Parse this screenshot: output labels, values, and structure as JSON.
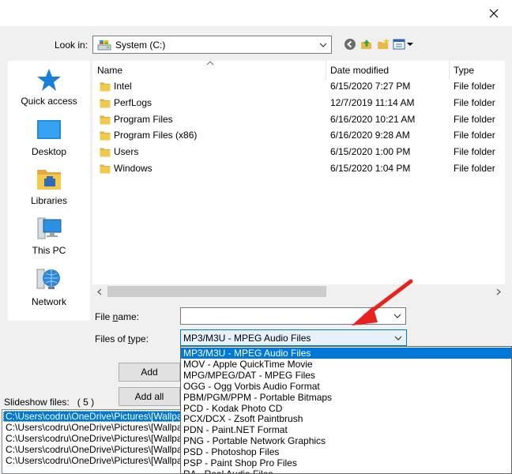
{
  "window": {
    "close_icon": "close-icon"
  },
  "toolbar": {
    "lookin_label": "Look in:",
    "lookin_value": "System (C:)",
    "drive_icon": "drive-icon",
    "back_icon": "back-icon",
    "up_icon": "up-folder-icon",
    "new_folder_icon": "new-folder-icon",
    "view_icon": "view-menu-icon"
  },
  "places": [
    {
      "label": "Quick access",
      "icon": "star-icon"
    },
    {
      "label": "Desktop",
      "icon": "desktop-icon"
    },
    {
      "label": "Libraries",
      "icon": "libraries-icon"
    },
    {
      "label": "This PC",
      "icon": "computer-icon"
    },
    {
      "label": "Network",
      "icon": "network-icon"
    }
  ],
  "filelist": {
    "columns": [
      "Name",
      "Date modified",
      "Type"
    ],
    "rows": [
      {
        "name": "Intel",
        "date": "6/15/2020 7:27 PM",
        "type": "File folder"
      },
      {
        "name": "PerfLogs",
        "date": "12/7/2019 11:14 AM",
        "type": "File folder"
      },
      {
        "name": "Program Files",
        "date": "6/16/2020 10:21 AM",
        "type": "File folder"
      },
      {
        "name": "Program Files (x86)",
        "date": "6/16/2020 9:28 AM",
        "type": "File folder"
      },
      {
        "name": "Users",
        "date": "6/15/2020 1:00 PM",
        "type": "File folder"
      },
      {
        "name": "Windows",
        "date": "6/15/2020 1:04 PM",
        "type": "File folder"
      }
    ]
  },
  "form": {
    "filename_label_pre": "File ",
    "filename_label_u": "n",
    "filename_label_post": "ame:",
    "filename_value": "",
    "filetype_label_pre": "Files of ",
    "filetype_label_u": "t",
    "filetype_label_post": "ype:",
    "filetype_value": "MP3/M3U - MPEG Audio Files",
    "filetype_options": [
      "MP3/M3U - MPEG Audio Files",
      "MOV - Apple QuickTime Movie",
      "MPG/MPEG/DAT - MPEG Files",
      "OGG - Ogg Vorbis Audio Format",
      "PBM/PGM/PPM - Portable Bitmaps",
      "PCD - Kodak Photo CD",
      "PCX/DCX - Zsoft Paintbrush",
      "PDN - Paint.NET Format",
      "PNG - Portable Network Graphics",
      "PSD - Photoshop Files",
      "PSP - Paint Shop Pro Files",
      "RA - Real Audio Files"
    ]
  },
  "buttons": {
    "add": "Add",
    "add_all": "Add all"
  },
  "slideshow": {
    "label": "Slideshow files:",
    "count": "( 5 )",
    "files": [
      "C:\\Users\\codru\\OneDrive\\Pictures\\[Wallpapers]",
      "C:\\Users\\codru\\OneDrive\\Pictures\\[Wallpapers]",
      "C:\\Users\\codru\\OneDrive\\Pictures\\[Wallpapers]",
      "C:\\Users\\codru\\OneDrive\\Pictures\\[Wallpapers]",
      "C:\\Users\\codru\\OneDrive\\Pictures\\[Wallpapers]"
    ]
  },
  "colors": {
    "accent": "#0078d7",
    "folder": "#dcb046",
    "annotation_arrow": "#e8231f"
  }
}
